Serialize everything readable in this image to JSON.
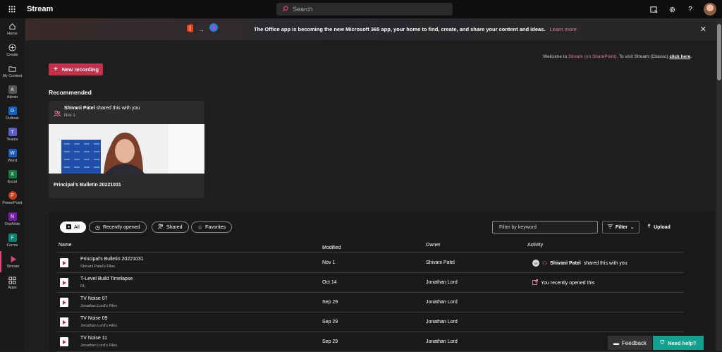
{
  "app": {
    "title": "Stream"
  },
  "search": {
    "placeholder": "Search"
  },
  "rail": {
    "items": [
      {
        "label": "Home",
        "icon": "home-icon"
      },
      {
        "label": "Create",
        "icon": "plus-circle-icon"
      },
      {
        "label": "My Content",
        "icon": "folder-icon"
      },
      {
        "label": "Admin",
        "icon": "admin-icon"
      },
      {
        "label": "Outlook",
        "icon": "outlook-icon"
      },
      {
        "label": "Teams",
        "icon": "teams-icon"
      },
      {
        "label": "Word",
        "icon": "word-icon"
      },
      {
        "label": "Excel",
        "icon": "excel-icon"
      },
      {
        "label": "PowerPoint",
        "icon": "powerpoint-icon"
      },
      {
        "label": "OneNote",
        "icon": "onenote-icon"
      },
      {
        "label": "Forms",
        "icon": "forms-icon"
      },
      {
        "label": "Stream",
        "icon": "stream-icon"
      },
      {
        "label": "Apps",
        "icon": "apps-icon"
      }
    ]
  },
  "banner": {
    "text": "The Office app is becoming the new Microsoft 365 app, your home to find, create, and share your content and ideas.",
    "link": "Learn more"
  },
  "welcome": {
    "prefix": "Welcome to ",
    "stream_link": "Stream (on SharePoint)",
    "middle": ". To visit Stream (Classic) ",
    "click_here": "click here",
    "suffix": "."
  },
  "new_recording": {
    "label": "New recording"
  },
  "recommended": {
    "heading": "Recommended",
    "card": {
      "sharer": "Shivani Patel",
      "shared_text": "shared this with you",
      "date": "Nov 1",
      "title": "Principal's Bulletin 20221031"
    }
  },
  "filters": {
    "pills": [
      {
        "label": "All",
        "icon": "stream-icon"
      },
      {
        "label": "Recently opened",
        "icon": "clock-icon"
      },
      {
        "label": "Shared",
        "icon": "people-icon"
      },
      {
        "label": "Favorites",
        "icon": "star-icon"
      }
    ],
    "keyword_placeholder": "Filter by keyword",
    "filter_label": "Filter",
    "upload_label": "Upload"
  },
  "table": {
    "headers": {
      "name": "Name",
      "modified": "Modified",
      "owner": "Owner",
      "activity": "Activity"
    },
    "rows": [
      {
        "name": "Principal's Bulletin 20221031",
        "sub": "Shivani Patel's Files",
        "modified": "Nov 1",
        "owner": "Shivani Patel",
        "activity_name": "Shivani Patel",
        "activity": "shared this with you",
        "activity_type": "shared"
      },
      {
        "name": "T-Level Build Timelapse",
        "sub": "DL",
        "modified": "Oct 14",
        "owner": "Jonathan Lord",
        "activity_name": "",
        "activity": "You recently opened this",
        "activity_type": "opened"
      },
      {
        "name": "TV Noise 07",
        "sub": "Jonathan Lord's Files",
        "modified": "Sep 29",
        "owner": "Jonathan Lord",
        "activity_name": "",
        "activity": "",
        "activity_type": ""
      },
      {
        "name": "TV Noise 09",
        "sub": "Jonathan Lord's Files",
        "modified": "Sep 29",
        "owner": "Jonathan Lord",
        "activity_name": "",
        "activity": "",
        "activity_type": ""
      },
      {
        "name": "TV Noise 11",
        "sub": "Jonathan Lord's Files",
        "modified": "Sep 29",
        "owner": "Jonathan Lord",
        "activity_name": "",
        "activity": "",
        "activity_type": ""
      }
    ]
  },
  "footer": {
    "feedback": "Feedback",
    "need_help": "Need help?"
  },
  "colors": {
    "accent": "#c4314b",
    "link_pink": "#e07a9d",
    "help_teal": "#12a18f",
    "background": "#1f1f1f"
  }
}
